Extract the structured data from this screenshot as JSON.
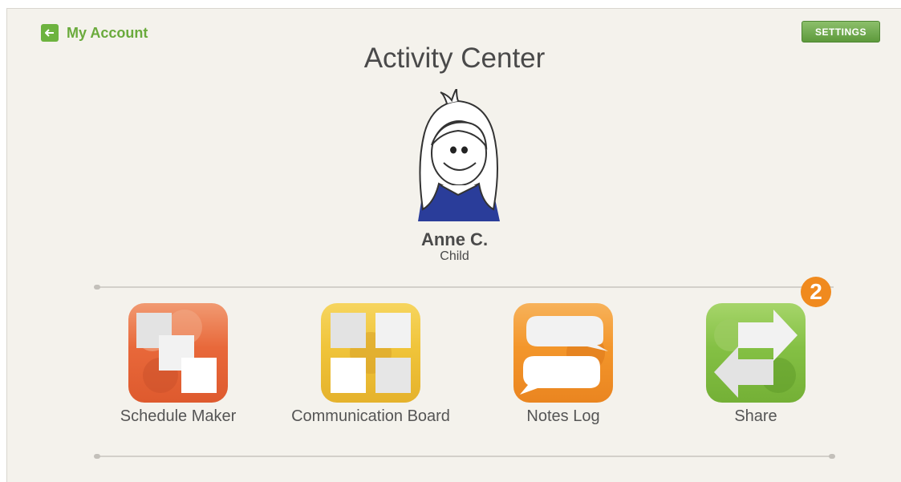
{
  "header": {
    "back_label": "My Account",
    "settings_label": "SETTINGS",
    "title": "Activity Center"
  },
  "profile": {
    "name": "Anne C.",
    "role": "Child"
  },
  "badge": "2",
  "apps": [
    {
      "label": "Schedule Maker",
      "icon": "schedule-maker-icon",
      "color": "#e8683a"
    },
    {
      "label": "Communication Board",
      "icon": "communication-board-icon",
      "color": "#f0c43a"
    },
    {
      "label": "Notes Log",
      "icon": "notes-log-icon",
      "color": "#f3962b"
    },
    {
      "label": "Share",
      "icon": "share-icon",
      "color": "#84c044"
    }
  ],
  "colors": {
    "background": "#f4f2ec",
    "accent_green": "#6aaa3c",
    "badge_orange": "#f08a1e"
  }
}
